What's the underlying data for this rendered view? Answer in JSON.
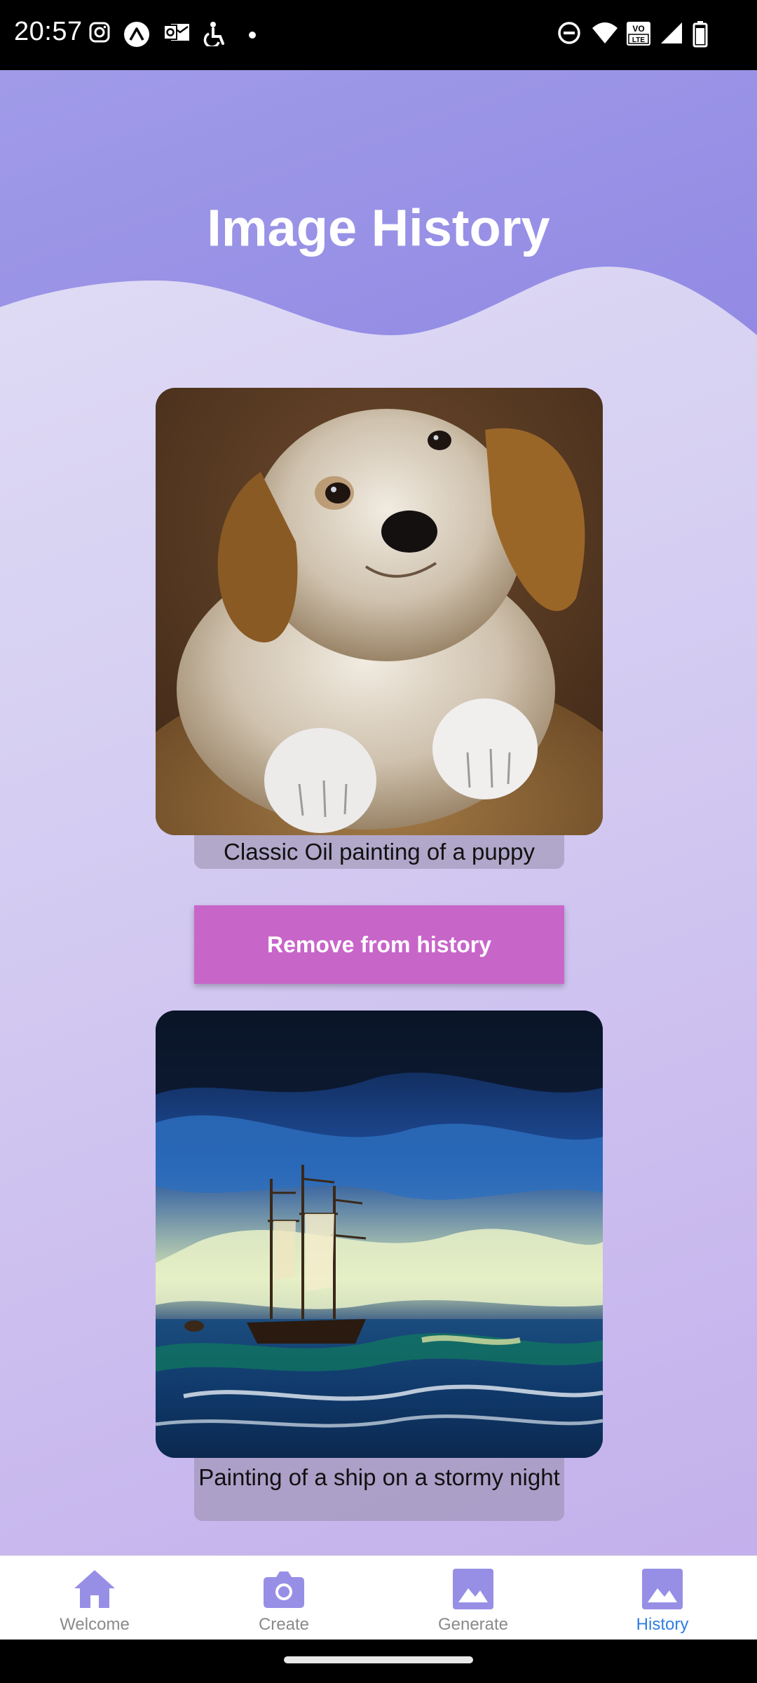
{
  "status_bar": {
    "time": "20:57",
    "left_icons": [
      "instagram-icon",
      "expo-icon",
      "outlook-icon",
      "accessibility-icon",
      "dot-icon"
    ],
    "right_icons": [
      "dnd-icon",
      "wifi-icon",
      "volte-icon",
      "signal-icon",
      "battery-icon"
    ],
    "volte_label": "VO LTE"
  },
  "header": {
    "title": "Image History",
    "colors": {
      "wave": "#978fe6",
      "title": "#ffffff"
    }
  },
  "history": {
    "items": [
      {
        "caption": "Classic Oil painting of a puppy",
        "image": "puppy-oil-painting"
      },
      {
        "caption": "Painting of a ship on a stormy night",
        "image": "ship-stormy-night-painting"
      }
    ],
    "remove_label": "Remove from history",
    "colors": {
      "button": "#c865c9",
      "caption_bg": "#968caa"
    }
  },
  "bottom_nav": {
    "items": [
      {
        "label": "Welcome",
        "icon": "home-icon",
        "active": false
      },
      {
        "label": "Create",
        "icon": "camera-icon",
        "active": false
      },
      {
        "label": "Generate",
        "icon": "image-icon",
        "active": false
      },
      {
        "label": "History",
        "icon": "image-icon",
        "active": true
      }
    ],
    "colors": {
      "icon": "#978fe6",
      "label": "#8a8a8a",
      "active_label": "#2f7fe0"
    }
  }
}
